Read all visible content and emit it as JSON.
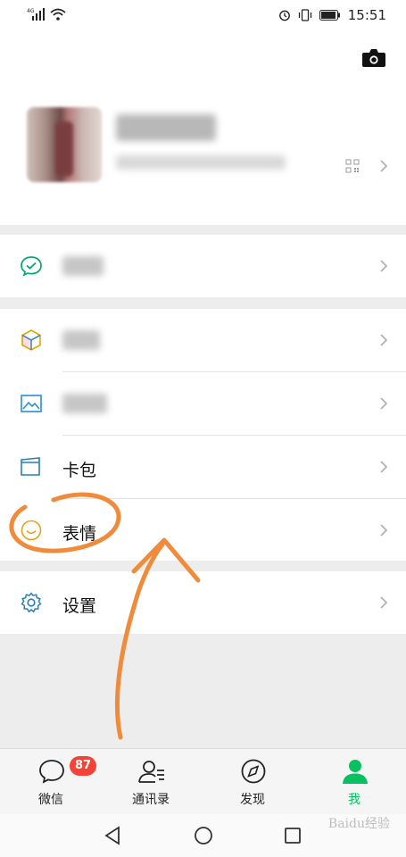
{
  "status_bar": {
    "signal_label": "4G",
    "time": "15:51",
    "icons": [
      "signal-icon",
      "wifi-icon",
      "alarm-icon",
      "vibrate-icon",
      "battery-icon"
    ]
  },
  "profile": {
    "camera_icon": "camera-icon",
    "qr_icon": "qr-code-icon"
  },
  "menu": {
    "pay_icon": "wechat-pay-icon",
    "favorites_icon": "cube-icon",
    "album_icon": "image-icon",
    "card_wallet": {
      "label": "卡包",
      "icon": "card-wallet-icon"
    },
    "stickers": {
      "label": "表情",
      "icon": "smiley-icon"
    },
    "settings": {
      "label": "设置",
      "icon": "gear-icon"
    }
  },
  "tabbar": {
    "tabs": [
      {
        "label": "微信",
        "icon": "chat-bubble-icon",
        "badge": "87"
      },
      {
        "label": "通讯录",
        "icon": "contacts-icon"
      },
      {
        "label": "发现",
        "icon": "compass-icon"
      },
      {
        "label": "我",
        "icon": "person-icon",
        "active": true
      }
    ],
    "active_color": "#07c160"
  },
  "navbar": {
    "icons": [
      "back-triangle-icon",
      "home-circle-icon",
      "recents-square-icon"
    ]
  },
  "watermark": "Baidu经验"
}
